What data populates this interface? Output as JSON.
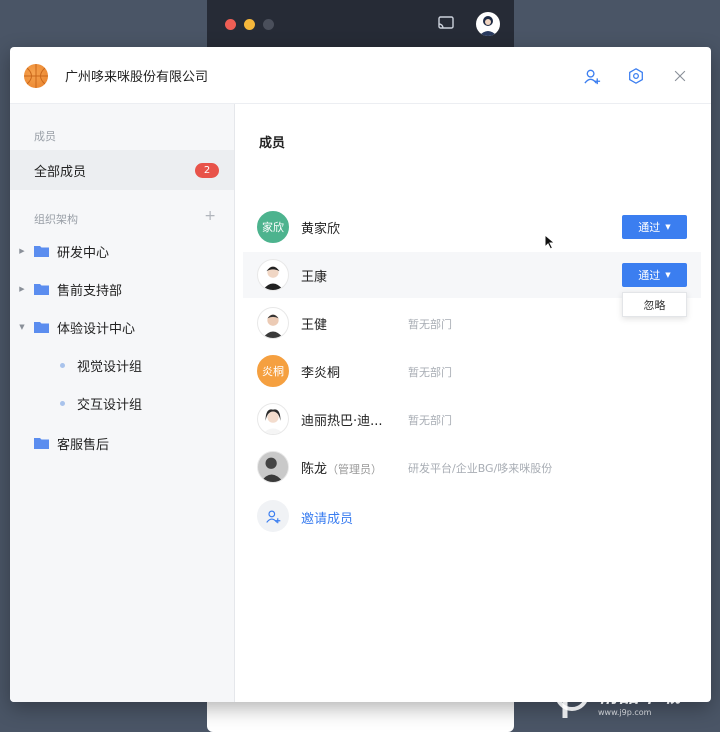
{
  "back_window": {
    "dot_colors": [
      "#ee5e55",
      "#f5b73b",
      "#4a4f5b"
    ]
  },
  "header": {
    "org_name": "广州哆来咪股份有限公司",
    "icons": [
      "add-user-icon",
      "settings-icon",
      "close-icon"
    ]
  },
  "sidebar": {
    "members_section": "成员",
    "all_members_label": "全部成员",
    "all_members_count": "2",
    "org_section": "组织架构",
    "tree": [
      {
        "label": "研发中心",
        "expanded": false
      },
      {
        "label": "售前支持部",
        "expanded": false
      },
      {
        "label": "体验设计中心",
        "expanded": true
      },
      {
        "label": "视觉设计组",
        "child": true
      },
      {
        "label": "交互设计组",
        "child": true
      },
      {
        "label": "客服售后",
        "expanded": false
      }
    ]
  },
  "main": {
    "title": "成员",
    "approve_label": "通过",
    "ignore_label": "忽略",
    "members": [
      {
        "name": "黄家欣",
        "avatar_text": "家欣",
        "avatar_color": "#4db38e",
        "dept": "",
        "pending": true
      },
      {
        "name": "王康",
        "avatar_text": "",
        "dept": "",
        "pending": true
      },
      {
        "name": "王健",
        "avatar_text": "",
        "dept": "暂无部门"
      },
      {
        "name": "李炎桐",
        "avatar_text": "炎桐",
        "avatar_color": "#f5a040",
        "dept": "暂无部门"
      },
      {
        "name": "迪丽热巴·迪...",
        "avatar_text": "",
        "dept": "暂无部门"
      },
      {
        "name": "陈龙",
        "role": "（管理员）",
        "avatar_text": "",
        "dept": "研发平台/企业BG/哆来咪股份"
      }
    ],
    "invite_label": "邀请成员"
  },
  "watermark": {
    "text": "精品下载",
    "sub": "www.j9p.com"
  },
  "colors": {
    "accent": "#3b7ef0",
    "badge": "#e8534a",
    "folder": "#5b8def"
  }
}
